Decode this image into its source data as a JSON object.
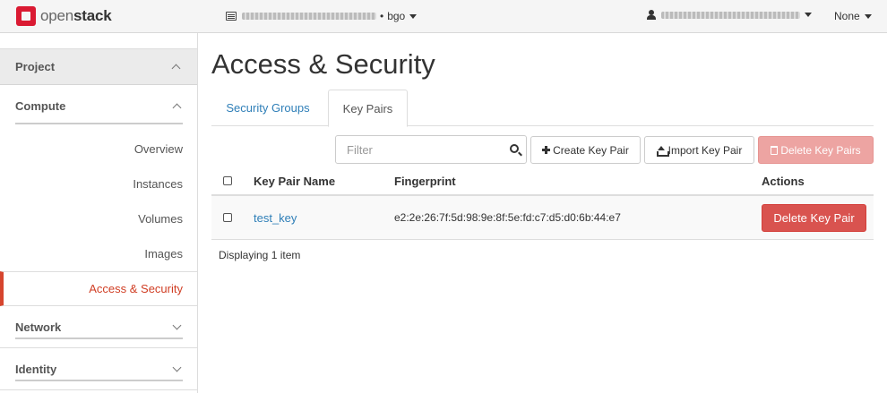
{
  "brand": {
    "prefix": "open",
    "suffix": "stack"
  },
  "project_switcher": {
    "project": "bgo"
  },
  "user_menu": {
    "region": "None"
  },
  "sidebar": {
    "project_label": "Project",
    "compute_label": "Compute",
    "compute_items": [
      "Overview",
      "Instances",
      "Volumes",
      "Images",
      "Access & Security"
    ],
    "active_item": "Access & Security",
    "network_label": "Network",
    "identity_label": "Identity"
  },
  "page": {
    "title": "Access & Security",
    "tabs": [
      {
        "label": "Security Groups",
        "active": false
      },
      {
        "label": "Key Pairs",
        "active": true
      }
    ]
  },
  "toolbar": {
    "filter_placeholder": "Filter",
    "create_label": "Create Key Pair",
    "import_label": "Import Key Pair",
    "delete_all_label": "Delete Key Pairs"
  },
  "table": {
    "headers": {
      "name": "Key Pair Name",
      "fingerprint": "Fingerprint",
      "actions": "Actions"
    },
    "rows": [
      {
        "name": "test_key",
        "fingerprint": "e2:2e:26:7f:5d:98:9e:8f:5e:fd:c7:d5:d0:6b:44:e7",
        "action": "Delete Key Pair"
      }
    ],
    "footer": "Displaying 1 item"
  },
  "colors": {
    "accent": "#d6452e",
    "link": "#2f7fb8",
    "danger": "#d9534f"
  }
}
